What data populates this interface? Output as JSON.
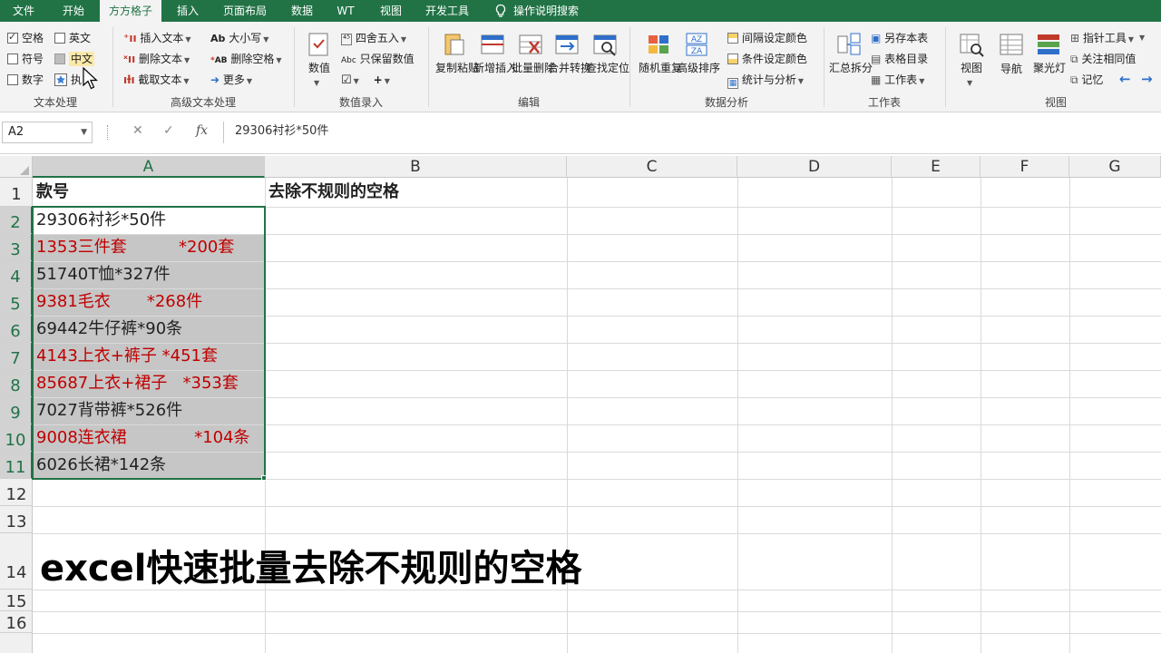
{
  "tabs": [
    "文件",
    "开始",
    "方方格子",
    "插入",
    "页面布局",
    "数据",
    "WT",
    "视图",
    "开发工具",
    "操作说明搜索"
  ],
  "ribbon": {
    "text_processing": {
      "title": "文本处理",
      "checks": [
        {
          "label": "空格",
          "checked": true
        },
        {
          "label": "英文",
          "checked": false
        },
        {
          "label": "符号",
          "checked": false
        },
        {
          "label": "中文",
          "checked": false
        },
        {
          "label": "数字",
          "checked": false
        },
        {
          "label": "执",
          "checked": false
        }
      ]
    },
    "advanced_text": {
      "title": "高级文本处理",
      "items": [
        "插入文本",
        "删除文本",
        "截取文本",
        "大小写",
        "删除空格",
        "更多"
      ]
    },
    "number_entry": {
      "title": "数值录入",
      "items": [
        "数值",
        "四舍五入",
        "只保留数值"
      ]
    },
    "edit": {
      "title": "编辑",
      "items": [
        "复制粘贴",
        "新增插入",
        "批量删除",
        "合并转换",
        "查找定位"
      ]
    },
    "data_analysis": {
      "title": "数据分析",
      "items": [
        "随机重复",
        "高级排序",
        "间隔设定颜色",
        "条件设定颜色",
        "统计与分析"
      ]
    },
    "worksheet": {
      "title": "工作表",
      "items": [
        "汇总拆分",
        "另存本表",
        "表格目录",
        "工作表"
      ]
    },
    "view": {
      "title": "视图",
      "items": [
        "视图",
        "导航",
        "聚光灯",
        "指针工具",
        "关注相同值",
        "记忆"
      ]
    }
  },
  "formula_bar": {
    "name_box": "A2",
    "formula": "29306衬衫*50件"
  },
  "columns": [
    "A",
    "B",
    "C",
    "D",
    "E",
    "F",
    "G"
  ],
  "rows": [
    "1",
    "2",
    "3",
    "4",
    "5",
    "6",
    "7",
    "8",
    "9",
    "10",
    "11",
    "12",
    "13",
    "14",
    "15",
    "16"
  ],
  "cells": {
    "A1": "款号",
    "B1": "去除不规则的空格",
    "col_a": [
      {
        "text": "29306衬衫*50件",
        "red": false
      },
      {
        "text": "1353三件套          *200套",
        "red": true
      },
      {
        "text": "51740T恤*327件",
        "red": false
      },
      {
        "text": "9381毛衣       *268件",
        "red": true
      },
      {
        "text": "69442牛仔裤*90条",
        "red": false
      },
      {
        "text": "4143上衣+裤子 *451套",
        "red": true
      },
      {
        "text": "85687上衣+裙子   *353套",
        "red": true
      },
      {
        "text": "7027背带裤*526件",
        "red": false
      },
      {
        "text": "9008连衣裙             *104条",
        "red": true
      },
      {
        "text": "6026长裙*142条",
        "red": false
      }
    ],
    "A14": "excel快速批量去除不规则的空格"
  }
}
